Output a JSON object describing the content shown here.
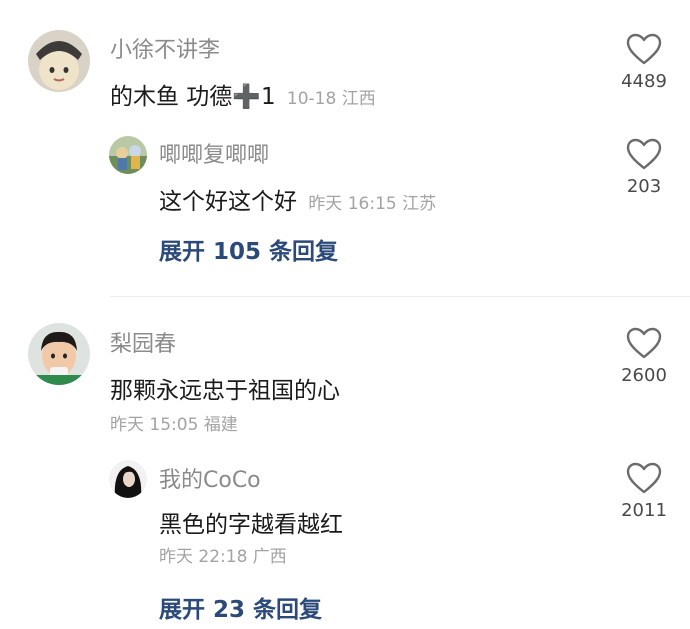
{
  "comments": [
    {
      "user": "小徐不讲李",
      "text": "的木鱼  功德",
      "emoji": "➕",
      "text_suffix": "1",
      "meta": "10-18 江西",
      "likes": "4489",
      "reply": {
        "user": "唧唧复唧唧",
        "text": "这个好这个好",
        "meta": "昨天 16:15 江苏",
        "likes": "203"
      },
      "expand_label": "展开 105 条回复"
    },
    {
      "user": "梨园春",
      "text": "那颗永远忠于祖国的心",
      "meta": "昨天 15:05 福建",
      "likes": "2600",
      "reply": {
        "user": "我的CoCo",
        "text": "黑色的字越看越红",
        "meta": "昨天 22:18 广西",
        "likes": "2011"
      },
      "expand_label": "展开 23 条回复"
    }
  ],
  "colors": {
    "accent_link": "#2b4a7a",
    "name_gray": "#8b8b8b",
    "meta_gray": "#a3a3a3"
  },
  "icons": [
    "heart-outline-icon",
    "plus-emoji"
  ]
}
